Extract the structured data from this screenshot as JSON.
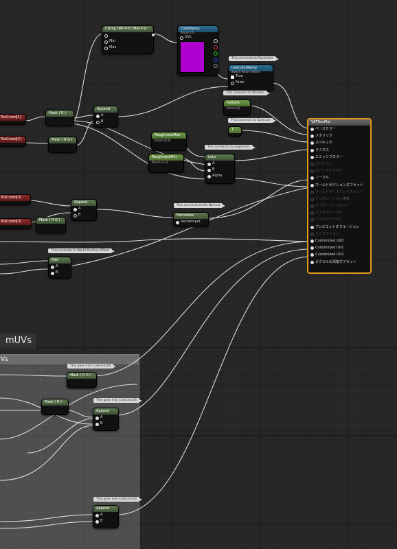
{
  "nodes": {
    "clamp": {
      "title": "Clamp (Min=0) (Max=1)",
      "pins": [
        "",
        "Min",
        "Max"
      ]
    },
    "color_ramp": {
      "title": "ColorRamp",
      "subtitle": "Param (2)",
      "pin": "UVs"
    },
    "use_color_ramp": {
      "title": "UseColorRamp",
      "subtitle": "Switch Param (False)",
      "pins": [
        "True",
        "False"
      ]
    },
    "texcoord1": {
      "title": "TexCoord[1]"
    },
    "texcoord2": {
      "title": "TexCoord[2]"
    },
    "texcoord3": {
      "title": "TexCoord[3]"
    },
    "texcoord4": {
      "title": "TexCoord[3]"
    },
    "mask_r": {
      "title": "Mask ( R )"
    },
    "mask_rg": {
      "title": "Mask ( R G )"
    },
    "append1": {
      "title": "Append",
      "pins": [
        "A",
        "B"
      ]
    },
    "metallic": {
      "title": "metallic",
      "subtitle": "Param (0)"
    },
    "one": {
      "title": "1"
    },
    "roughness_max": {
      "title": "RoughnessMax",
      "subtitle": "Param (0.8)"
    },
    "roughness_min": {
      "title": "RoughnessMin",
      "subtitle": "Param (0.3)"
    },
    "lerp": {
      "title": "Lerp",
      "pins": [
        "A",
        "B",
        "Alpha"
      ]
    },
    "append2": {
      "title": "Append",
      "pins": [
        "A",
        "B"
      ]
    },
    "mask_rg2": {
      "title": "Mask ( R G )"
    },
    "normalize": {
      "title": "Normalize",
      "pin": "VectorInput"
    },
    "add": {
      "title": "Add",
      "pins": [
        "A",
        "B"
      ]
    },
    "mask_rg3": {
      "title": "Mask ( R G )"
    },
    "mask_r2": {
      "title": "Mask ( R )"
    },
    "append3": {
      "title": "Append",
      "pins": [
        "A",
        "B"
      ]
    },
    "append4": {
      "title": "Append",
      "pins": [
        "A",
        "B"
      ]
    }
  },
  "tags": {
    "base_color": "This connects to BaseColor",
    "metallic": "This connects to Metallic",
    "specular": "This connects to Specular",
    "roughness": "This connects to roughness",
    "normal": "This connects to the Normal",
    "wpo": "This connects to World Position Offset",
    "uv0": "This goes into CustomUV0",
    "uv1": "This goes into CustomUV1",
    "uv2": "This goes into CustomUV2"
  },
  "material": {
    "title": "VATTestMat",
    "pins": [
      {
        "label": "ベースカラー",
        "active": true
      },
      {
        "label": "メタリック",
        "active": true
      },
      {
        "label": "スペキュラ",
        "active": true
      },
      {
        "label": "ラフネス",
        "active": true
      },
      {
        "label": "エミッシブカラー",
        "active": true
      },
      {
        "label": "オパシティ",
        "active": false
      },
      {
        "label": "オパシティマスク",
        "active": false
      },
      {
        "label": "ノーマル",
        "active": true
      },
      {
        "label": "ワールドポジションオフセット",
        "active": true
      },
      {
        "label": "ワールドディスプレイスメント",
        "active": false
      },
      {
        "label": "テッセレーション乗数",
        "active": false
      },
      {
        "label": "サブサーフェスカラー",
        "active": false
      },
      {
        "label": "カスタムデータ0",
        "active": false
      },
      {
        "label": "カスタムデータ1",
        "active": false
      },
      {
        "label": "アンビエントオクルージョン",
        "active": true
      },
      {
        "label": "リフラクション",
        "active": false
      },
      {
        "label": "Customized UV0",
        "active": true
      },
      {
        "label": "Customized UV1",
        "active": true
      },
      {
        "label": "Customized UV2",
        "active": true
      },
      {
        "label": "ピクセルの深度オフセット",
        "active": true
      }
    ]
  },
  "comment": {
    "title": "mUVs",
    "bar": "Vs"
  },
  "colors": {
    "ramp_swatch": "#b000d0",
    "material_border": "#e69a1a",
    "wire": "#dcdcdc"
  }
}
